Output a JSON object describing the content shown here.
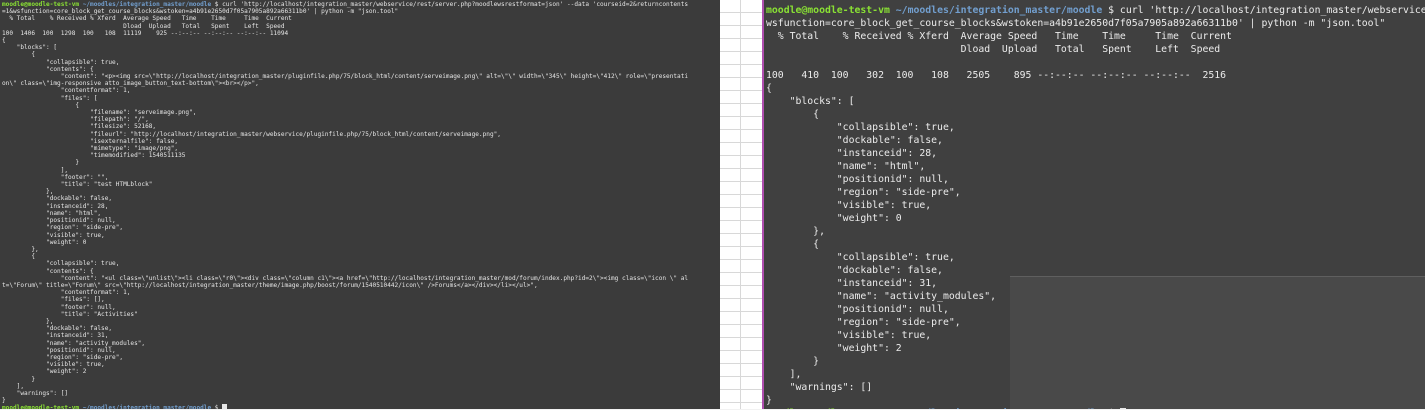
{
  "left_terminal": {
    "lines": [
      {
        "type": "prompt",
        "user": "moodle@moodle-test-vm",
        "path": "~/moodles/integration_master/moodle",
        "cmd": " $ curl 'http://localhost/integration_master/webservice/rest/server.php?moodlewsrestformat=json' --data 'courseid=2&returncontents"
      },
      {
        "type": "text",
        "text": "=1&wsfunction=core_block_get_course_blocks&wstoken=a4b91e2650d7f05a7905a892a66311b0' | python -m \"json.tool\""
      },
      {
        "type": "text",
        "text": "  % Total    % Received % Xferd  Average Speed   Time    Time     Time  Current"
      },
      {
        "type": "text",
        "text": "                                 Dload  Upload   Total   Spent    Left  Speed"
      },
      {
        "type": "text",
        "text": "100  1406  100  1298  100   108  11119    925 --:--:-- --:--:-- --:--:-- 11094"
      },
      {
        "type": "text",
        "text": "{"
      },
      {
        "type": "text",
        "text": "    \"blocks\": ["
      },
      {
        "type": "text",
        "text": "        {"
      },
      {
        "type": "text",
        "text": "            \"collapsible\": true,"
      },
      {
        "type": "text",
        "text": "            \"contents\": {"
      },
      {
        "type": "text",
        "text": "                \"content\": \"<p><img src=\\\"http://localhost/integration_master/pluginfile.php/75/block_html/content/serveimage.png\\\" alt=\\\"\\\" width=\\\"345\\\" height=\\\"412\\\" role=\\\"presentati"
      },
      {
        "type": "text",
        "text": "on\\\" class=\\\"img-responsive atto_image_button_text-bottom\\\"><br></p>\","
      },
      {
        "type": "text",
        "text": "                \"contentformat\": 1,"
      },
      {
        "type": "text",
        "text": "                \"files\": ["
      },
      {
        "type": "text",
        "text": "                    {"
      },
      {
        "type": "text",
        "text": "                        \"filename\": \"serveimage.png\","
      },
      {
        "type": "text",
        "text": "                        \"filepath\": \"/\","
      },
      {
        "type": "text",
        "text": "                        \"filesize\": 52168,"
      },
      {
        "type": "text",
        "text": "                        \"fileurl\": \"http://localhost/integration_master/webservice/pluginfile.php/75/block_html/content/serveimage.png\","
      },
      {
        "type": "text",
        "text": "                        \"isexternalfile\": false,"
      },
      {
        "type": "text",
        "text": "                        \"mimetype\": \"image/png\","
      },
      {
        "type": "text",
        "text": "                        \"timemodified\": 1540511135"
      },
      {
        "type": "text",
        "text": "                    }"
      },
      {
        "type": "text",
        "text": "                ],"
      },
      {
        "type": "text",
        "text": "                \"footer\": \"\","
      },
      {
        "type": "text",
        "text": "                \"title\": \"test HTMLblock\""
      },
      {
        "type": "text",
        "text": "            },"
      },
      {
        "type": "text",
        "text": "            \"dockable\": false,"
      },
      {
        "type": "text",
        "text": "            \"instanceid\": 28,"
      },
      {
        "type": "text",
        "text": "            \"name\": \"html\","
      },
      {
        "type": "text",
        "text": "            \"positionid\": null,"
      },
      {
        "type": "text",
        "text": "            \"region\": \"side-pre\","
      },
      {
        "type": "text",
        "text": "            \"visible\": true,"
      },
      {
        "type": "text",
        "text": "            \"weight\": 0"
      },
      {
        "type": "text",
        "text": "        },"
      },
      {
        "type": "text",
        "text": "        {"
      },
      {
        "type": "text",
        "text": "            \"collapsible\": true,"
      },
      {
        "type": "text",
        "text": "            \"contents\": {"
      },
      {
        "type": "text",
        "text": "                \"content\": \"<ul class=\\\"unlist\\\"><li class=\\\"r0\\\"><div class=\\\"column c1\\\"><a href=\\\"http://localhost/integration_master/mod/forum/index.php?id=2\\\"><img class=\\\"icon \\\" al"
      },
      {
        "type": "text",
        "text": "t=\\\"Forum\\\" title=\\\"Forum\\\" src=\\\"http://localhost/integration_master/theme/image.php/boost/forum/1540510442/icon\\\" />Forums</a></div></li></ul>\","
      },
      {
        "type": "text",
        "text": "                \"contentformat\": 1,"
      },
      {
        "type": "text",
        "text": "                \"files\": [],"
      },
      {
        "type": "text",
        "text": "                \"footer\": null,"
      },
      {
        "type": "text",
        "text": "                \"title\": \"Activities\""
      },
      {
        "type": "text",
        "text": "            },"
      },
      {
        "type": "text",
        "text": "            \"dockable\": false,"
      },
      {
        "type": "text",
        "text": "            \"instanceid\": 31,"
      },
      {
        "type": "text",
        "text": "            \"name\": \"activity_modules\","
      },
      {
        "type": "text",
        "text": "            \"positionid\": null,"
      },
      {
        "type": "text",
        "text": "            \"region\": \"side-pre\","
      },
      {
        "type": "text",
        "text": "            \"visible\": true,"
      },
      {
        "type": "text",
        "text": "            \"weight\": 2"
      },
      {
        "type": "text",
        "text": "        }"
      },
      {
        "type": "text",
        "text": "    ],"
      },
      {
        "type": "text",
        "text": "    \"warnings\": []"
      },
      {
        "type": "text",
        "text": "}"
      },
      {
        "type": "prompt_end",
        "user": "moodle@moodle-test-vm",
        "path": "~/moodles/integration_master/moodle",
        "cmd": " $ "
      }
    ]
  },
  "right_terminal": {
    "lines": [
      {
        "type": "prompt",
        "user": "moodle@moodle-test-vm",
        "path": "~/moodles/integration_master/moodle",
        "cmd": " $ curl 'http://localhost/integration_master/webservice/rest/server.php?moodlewsrestformat=json' --data"
      },
      {
        "type": "text",
        "text": "wsfunction=core_block_get_course_blocks&wstoken=a4b91e2650d7f05a7905a892a66311b0' | python -m \"json.tool\""
      },
      {
        "type": "text",
        "text": "  % Total    % Received % Xferd  Average Speed   Time    Time     Time  Current"
      },
      {
        "type": "text",
        "text": "                                 Dload  Upload   Total   Spent    Left  Speed"
      },
      {
        "type": "text",
        "text": ""
      },
      {
        "type": "text",
        "text": "100   410  100   302  100   108   2505    895 --:--:-- --:--:-- --:--:--  2516"
      },
      {
        "type": "text",
        "text": "{"
      },
      {
        "type": "text",
        "text": "    \"blocks\": ["
      },
      {
        "type": "text",
        "text": "        {"
      },
      {
        "type": "text",
        "text": "            \"collapsible\": true,"
      },
      {
        "type": "text",
        "text": "            \"dockable\": false,"
      },
      {
        "type": "text",
        "text": "            \"instanceid\": 28,"
      },
      {
        "type": "text",
        "text": "            \"name\": \"html\","
      },
      {
        "type": "text",
        "text": "            \"positionid\": null,"
      },
      {
        "type": "text",
        "text": "            \"region\": \"side-pre\","
      },
      {
        "type": "text",
        "text": "            \"visible\": true,"
      },
      {
        "type": "text",
        "text": "            \"weight\": 0"
      },
      {
        "type": "text",
        "text": "        },"
      },
      {
        "type": "text",
        "text": "        {"
      },
      {
        "type": "text",
        "text": "            \"collapsible\": true,"
      },
      {
        "type": "text",
        "text": "            \"dockable\": false,"
      },
      {
        "type": "text",
        "text": "            \"instanceid\": 31,"
      },
      {
        "type": "text",
        "text": "            \"name\": \"activity_modules\","
      },
      {
        "type": "text",
        "text": "            \"positionid\": null,"
      },
      {
        "type": "text",
        "text": "            \"region\": \"side-pre\","
      },
      {
        "type": "text",
        "text": "            \"visible\": true,"
      },
      {
        "type": "text",
        "text": "            \"weight\": 2"
      },
      {
        "type": "text",
        "text": "        }"
      },
      {
        "type": "text",
        "text": "    ],"
      },
      {
        "type": "text",
        "text": "    \"warnings\": []"
      },
      {
        "type": "text",
        "text": "}"
      },
      {
        "type": "prompt_end",
        "user": "moodle@moodle-test-vm",
        "path": "~/moodles/integration_master/moodle",
        "cmd": " $ "
      }
    ]
  },
  "colors": {
    "prompt_user": "#8ae234",
    "prompt_path": "#729fcf",
    "terminal_bg_left": "#3b3b3b",
    "terminal_bg_right": "#404040",
    "terminal_fg": "#e6e6e6"
  }
}
